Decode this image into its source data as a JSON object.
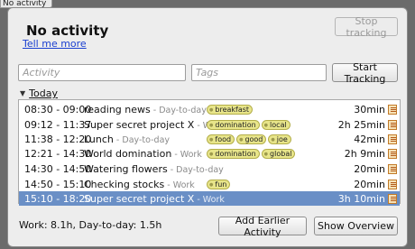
{
  "window": {
    "title_fragment": "No activity"
  },
  "status": {
    "title": "No activity",
    "stop_label": "Stop tracking",
    "tell_more": "Tell me more"
  },
  "entry": {
    "activity_placeholder": "Activity",
    "tags_placeholder": "Tags",
    "start_label": "Start Tracking"
  },
  "day": {
    "label": "Today"
  },
  "facts": [
    {
      "time": "08:30 - 09:00",
      "name": "reading news",
      "category": " - Day-to-day",
      "tags": [
        "breakfast"
      ],
      "duration": "30min",
      "selected": false
    },
    {
      "time": "09:12 - 11:37",
      "name": "Super secret project X",
      "category": " - Work",
      "tags": [
        "domination",
        "local"
      ],
      "duration": "2h 25min",
      "selected": false
    },
    {
      "time": "11:38 - 12:20",
      "name": "Lunch",
      "category": " - Day-to-day",
      "tags": [
        "food",
        "good",
        "joe"
      ],
      "duration": "42min",
      "selected": false
    },
    {
      "time": "12:21 - 14:30",
      "name": "World domination",
      "category": " - Work",
      "tags": [
        "domination",
        "global"
      ],
      "duration": "2h 9min",
      "selected": false
    },
    {
      "time": "14:30 - 14:50",
      "name": "Watering flowers",
      "category": " - Day-to-day",
      "tags": [],
      "duration": "20min",
      "selected": false
    },
    {
      "time": "14:50 - 15:10",
      "name": "Checking stocks",
      "category": " - Work",
      "tags": [
        "fun"
      ],
      "duration": "20min",
      "selected": false
    },
    {
      "time": "15:10 - 18:20",
      "name": "Super secret project X",
      "category": " - Work",
      "tags": [],
      "duration": "3h 10min",
      "selected": true
    }
  ],
  "footer": {
    "totals": "Work: 8.1h, Day-to-day: 1.5h",
    "add_earlier_label": "Add Earlier Activity",
    "overview_label": "Show Overview"
  },
  "colors": {
    "selection": "#6a8fc6",
    "tag_fill": "#e8e58a",
    "link": "#1a3fd0"
  },
  "icons": {
    "edit": "edit-icon",
    "expander": "triangle-down-icon"
  }
}
